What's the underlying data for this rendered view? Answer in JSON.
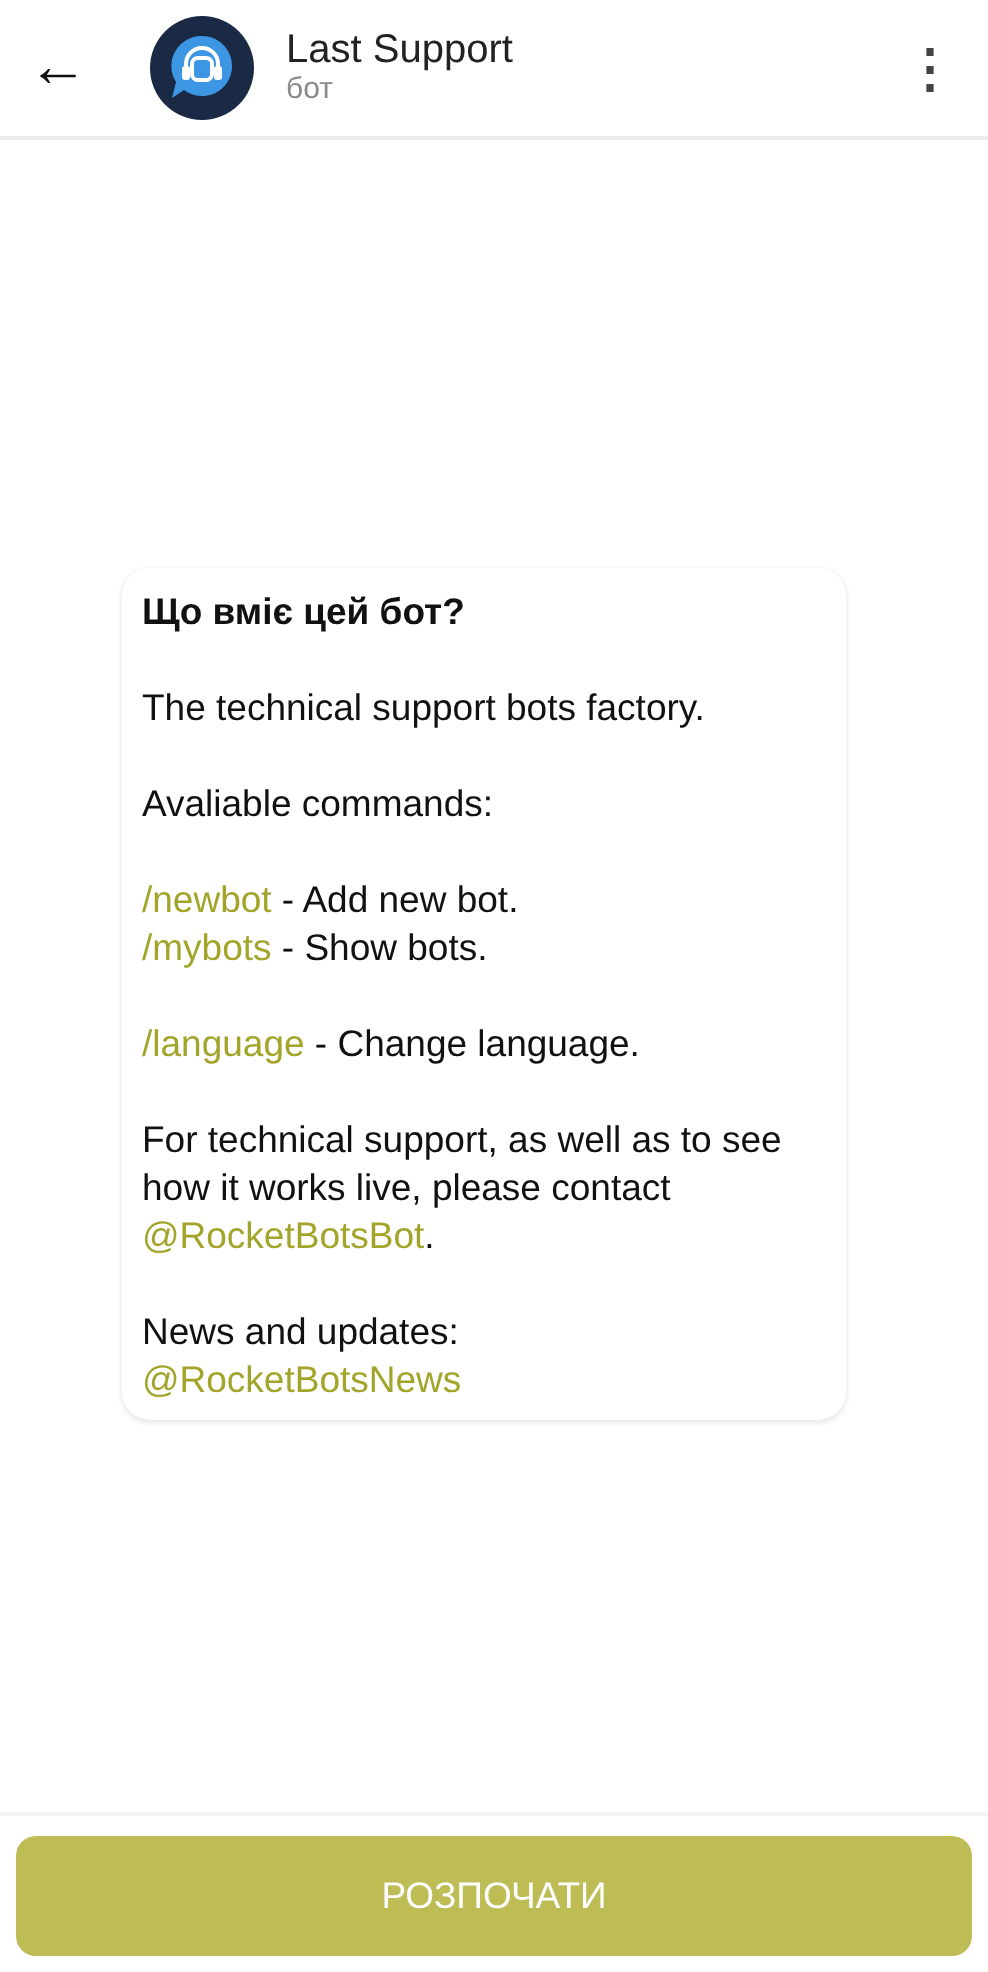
{
  "header": {
    "back_icon": "←",
    "title": "Last Support",
    "subtitle": "бот",
    "menu_icon": "⋮"
  },
  "intro_card": {
    "title": "Що вміє цей бот?",
    "paragraphs": [
      {
        "lines": [
          [
            {
              "kind": "text",
              "text": "The technical support bots factory."
            }
          ]
        ]
      },
      {
        "lines": [
          [
            {
              "kind": "text",
              "text": "Avaliable commands:"
            }
          ]
        ]
      },
      {
        "lines": [
          [
            {
              "kind": "command",
              "text": "/newbot"
            },
            {
              "kind": "text",
              "text": " - Add new bot."
            }
          ],
          [
            {
              "kind": "command",
              "text": "/mybots"
            },
            {
              "kind": "text",
              "text": " - Show bots."
            }
          ]
        ]
      },
      {
        "lines": [
          [
            {
              "kind": "command",
              "text": "/language"
            },
            {
              "kind": "text",
              "text": " - Change language."
            }
          ]
        ]
      },
      {
        "lines": [
          [
            {
              "kind": "text",
              "text": "For technical support, as well as to see how it works live, please contact "
            },
            {
              "kind": "mention",
              "text": "@RocketBotsBot"
            },
            {
              "kind": "text",
              "text": "."
            }
          ]
        ]
      },
      {
        "lines": [
          [
            {
              "kind": "text",
              "text": "News and updates:"
            }
          ],
          [
            {
              "kind": "mention",
              "text": "@RocketBotsNews"
            }
          ]
        ]
      }
    ]
  },
  "start_button": {
    "label": "РОЗПОЧАТИ"
  }
}
